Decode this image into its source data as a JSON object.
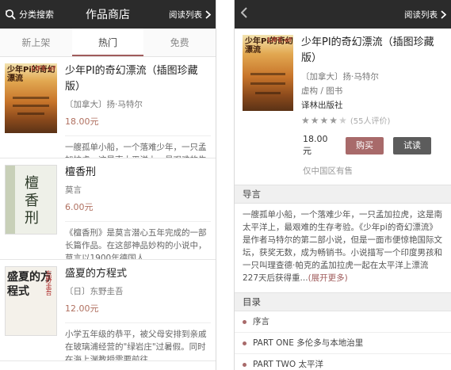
{
  "left": {
    "header": {
      "category": "分类搜索",
      "title": "作品商店",
      "readlist": "阅读列表"
    },
    "tabs": [
      "新上架",
      "热门",
      "免费"
    ],
    "books": [
      {
        "title": "少年PI的奇幻漂流（插图珍藏版）",
        "author": "〔加拿大〕扬·马特尔",
        "price": "18.00元",
        "desc": "一艘孤单小船，一个落难少年，一只孟加拉虎，这是南太平洋上，最艰难的生存考验。《少年pi的奇 ...",
        "cover_text": "少年Pi的奇幻漂流",
        "cover_corner": "LIFE of"
      },
      {
        "title": "檀香刑",
        "author": "莫言",
        "price": "6.00元",
        "desc": "《檀香刑》是莫言潜心五年完成的一部长篇作品。在这部神品妙构的小说中，莫言以1900年德国人 ...",
        "cover_text": "檀香刑"
      },
      {
        "title": "盛夏的方程式",
        "author": "〔日〕东野圭吾",
        "price": "12.00元",
        "desc": "小学五年级的恭平，被父母安排到亲戚在玻璃浦经营的\"绿岩庄\"过暑假。同时在海上渊教授需要前往",
        "cover_text": "盛夏的方程式",
        "cover_corner": "东野圭吾"
      }
    ]
  },
  "right": {
    "header": {
      "readlist": "阅读列表"
    },
    "book": {
      "title": "少年PI的奇幻漂流（插图珍藏版）",
      "author": "〔加拿大〕扬·马特尔",
      "category": "虚构 / 图书",
      "publisher": "译林出版社",
      "rating_count": "(55人评价)",
      "rating": 4,
      "price": "18.00元",
      "buy_label": "购买",
      "try_label": "试读",
      "region": "仅中国区有售",
      "cover_text": "少年Pi的奇幻漂流",
      "cover_corner": "LIFE of"
    },
    "intro_title": "导言",
    "intro_text": "一艘孤单小船，一个落难少年，一只孟加拉虎，这是南太平洋上，最艰难的生存考验。《少年pi的奇幻漂流》是作者马特尔的第二部小说，但是一面市便惊艳国际文坛，获奖无数，成为畅销书。小说描写一个印度男孩和一只叫理查德·帕克的孟加拉虎一起在太平洋上漂流227天后获得重...",
    "intro_more": "(展开更多)",
    "toc_title": "目录",
    "toc": [
      "序言",
      "PART ONE 多伦多与本地治里",
      "PART TWO 太平洋"
    ]
  }
}
